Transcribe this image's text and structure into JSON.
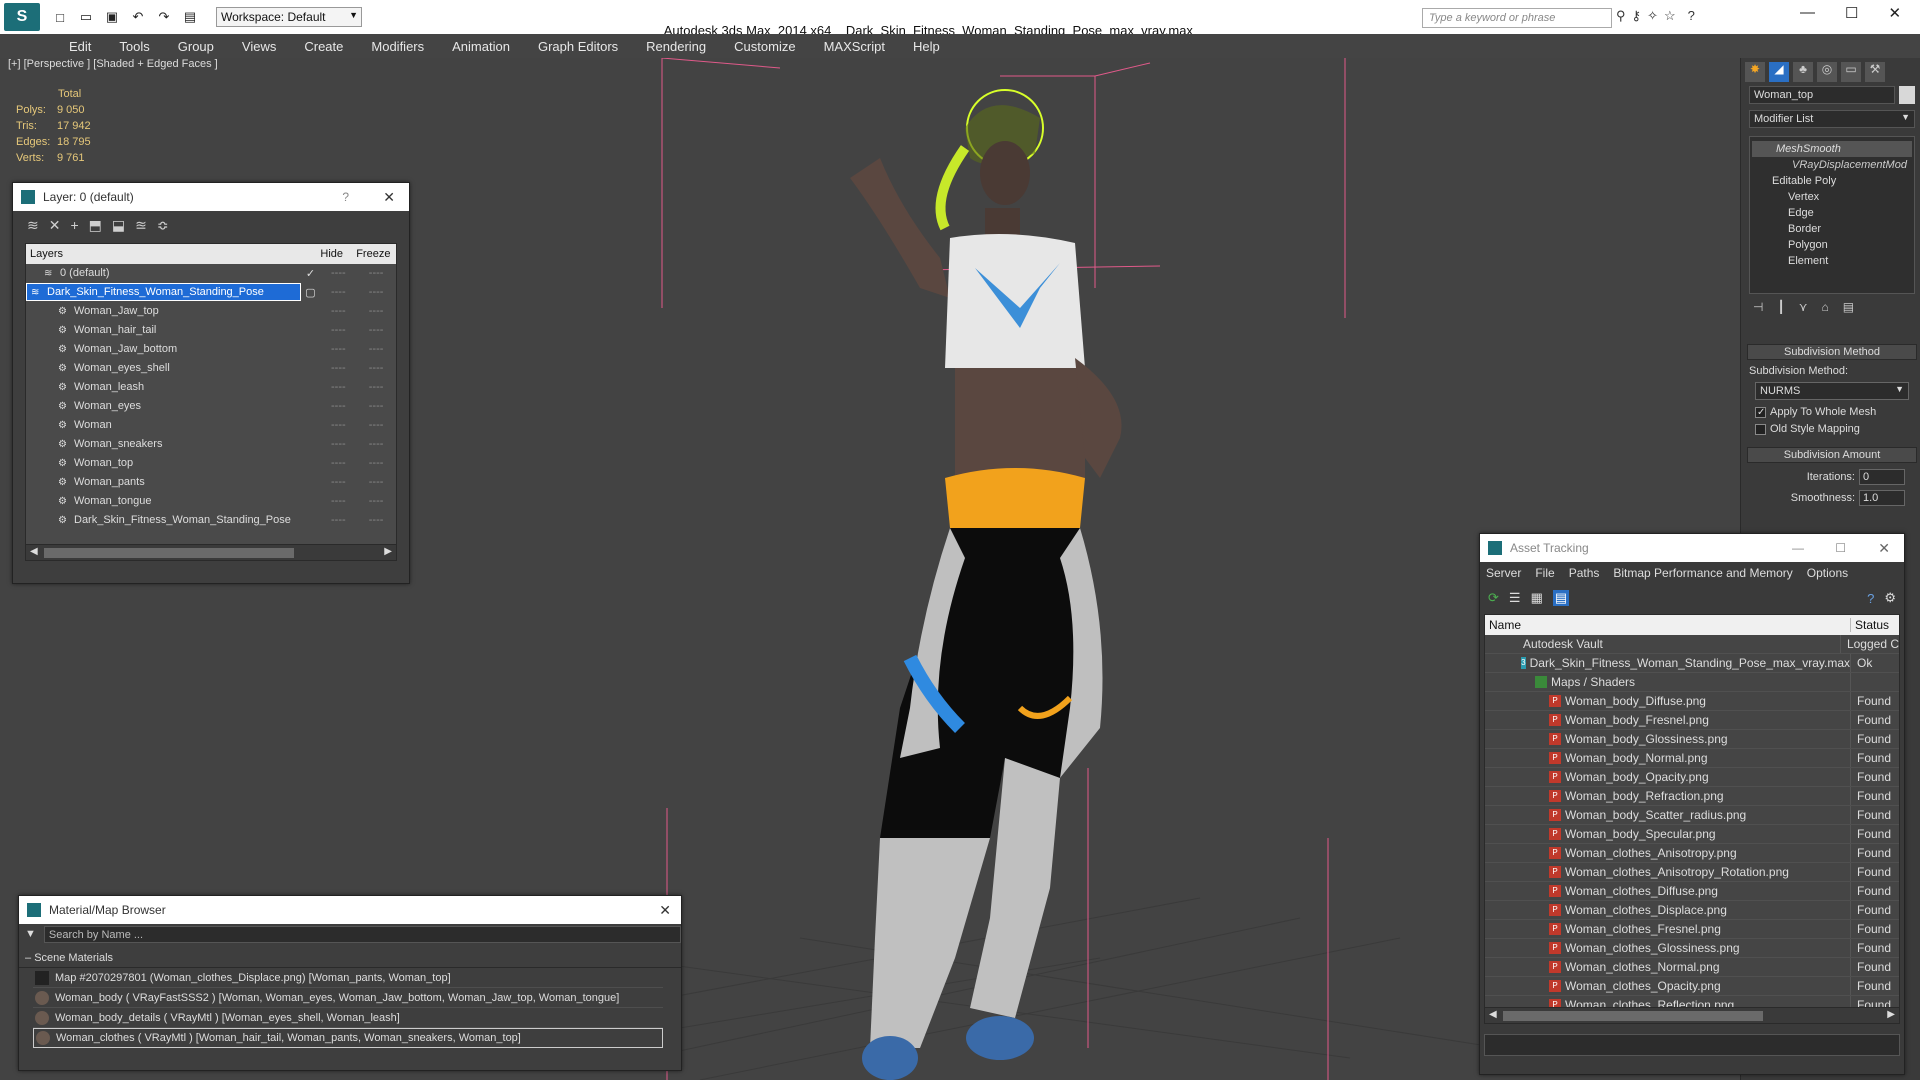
{
  "app": {
    "title": "Autodesk 3ds Max  2014 x64",
    "filename": "Dark_Skin_Fitness_Woman_Standing_Pose_max_vray.max",
    "workspace": "Workspace: Default",
    "search_placeholder": "Type a keyword or phrase"
  },
  "menu": [
    "Edit",
    "Tools",
    "Group",
    "Views",
    "Create",
    "Modifiers",
    "Animation",
    "Graph Editors",
    "Rendering",
    "Customize",
    "MAXScript",
    "Help"
  ],
  "viewport": {
    "label": "[+] [Perspective ] [Shaded + Edged Faces ]",
    "stats": {
      "header": "Total",
      "polys_label": "Polys:",
      "polys": "9 050",
      "tris_label": "Tris:",
      "tris": "17 942",
      "edges_label": "Edges:",
      "edges": "18 795",
      "verts_label": "Verts:",
      "verts": "9 761"
    }
  },
  "layer_window": {
    "title": "Layer: 0 (default)",
    "help": "?",
    "col_layers": "Layers",
    "col_hide": "Hide",
    "col_freeze": "Freeze",
    "rows": [
      "0 (default)",
      "Dark_Skin_Fitness_Woman_Standing_Pose",
      "Woman_Jaw_top",
      "Woman_hair_tail",
      "Woman_Jaw_bottom",
      "Woman_eyes_shell",
      "Woman_leash",
      "Woman_eyes",
      "Woman",
      "Woman_sneakers",
      "Woman_top",
      "Woman_pants",
      "Woman_tongue",
      "Dark_Skin_Fitness_Woman_Standing_Pose"
    ]
  },
  "material_browser": {
    "title": "Material/Map Browser",
    "search": "Search by Name ...",
    "section": "Scene Materials",
    "items": [
      "Map #2070297801 (Woman_clothes_Displace.png) [Woman_pants, Woman_top]",
      "Woman_body  ( VRayFastSSS2 ) [Woman, Woman_eyes, Woman_Jaw_bottom, Woman_Jaw_top, Woman_tongue]",
      "Woman_body_details  ( VRayMtl ) [Woman_eyes_shell, Woman_leash]",
      "Woman_clothes  ( VRayMtl ) [Woman_hair_tail, Woman_pants, Woman_sneakers, Woman_top]"
    ]
  },
  "command_panel": {
    "object_name": "Woman_top",
    "modifier_list": "Modifier List",
    "stack": [
      "MeshSmooth",
      "VRayDisplacementMod",
      "Editable Poly",
      "Vertex",
      "Edge",
      "Border",
      "Polygon",
      "Element"
    ],
    "subdiv_method_header": "Subdivision Method",
    "subdiv_method_label": "Subdivision Method:",
    "subdiv_method_value": "NURMS",
    "apply_whole": "Apply To Whole Mesh",
    "old_style": "Old Style Mapping",
    "subdiv_amount_header": "Subdivision Amount",
    "iterations_label": "Iterations:",
    "iterations": "0",
    "smoothness_label": "Smoothness:",
    "smoothness": "1.0"
  },
  "asset_tracking": {
    "title": "Asset Tracking",
    "menu": [
      "Server",
      "File",
      "Paths",
      "Bitmap Performance and Memory",
      "Options"
    ],
    "col_name": "Name",
    "col_status": "Status",
    "rows": [
      {
        "name": "Autodesk Vault",
        "status": "Logged C",
        "indent": 1
      },
      {
        "name": "Dark_Skin_Fitness_Woman_Standing_Pose_max_vray.max",
        "status": "Ok",
        "indent": 2
      },
      {
        "name": "Maps / Shaders",
        "status": "",
        "indent": 3
      },
      {
        "name": "Woman_body_Diffuse.png",
        "status": "Found",
        "indent": 4
      },
      {
        "name": "Woman_body_Fresnel.png",
        "status": "Found",
        "indent": 4
      },
      {
        "name": "Woman_body_Glossiness.png",
        "status": "Found",
        "indent": 4
      },
      {
        "name": "Woman_body_Normal.png",
        "status": "Found",
        "indent": 4
      },
      {
        "name": "Woman_body_Opacity.png",
        "status": "Found",
        "indent": 4
      },
      {
        "name": "Woman_body_Refraction.png",
        "status": "Found",
        "indent": 4
      },
      {
        "name": "Woman_body_Scatter_radius.png",
        "status": "Found",
        "indent": 4
      },
      {
        "name": "Woman_body_Specular.png",
        "status": "Found",
        "indent": 4
      },
      {
        "name": "Woman_clothes_Anisotropy.png",
        "status": "Found",
        "indent": 4
      },
      {
        "name": "Woman_clothes_Anisotropy_Rotation.png",
        "status": "Found",
        "indent": 4
      },
      {
        "name": "Woman_clothes_Diffuse.png",
        "status": "Found",
        "indent": 4
      },
      {
        "name": "Woman_clothes_Displace.png",
        "status": "Found",
        "indent": 4
      },
      {
        "name": "Woman_clothes_Fresnel.png",
        "status": "Found",
        "indent": 4
      },
      {
        "name": "Woman_clothes_Glossiness.png",
        "status": "Found",
        "indent": 4
      },
      {
        "name": "Woman_clothes_Normal.png",
        "status": "Found",
        "indent": 4
      },
      {
        "name": "Woman_clothes_Opacity.png",
        "status": "Found",
        "indent": 4
      },
      {
        "name": "Woman_clothes_Reflection.png",
        "status": "Found",
        "indent": 4
      }
    ]
  }
}
